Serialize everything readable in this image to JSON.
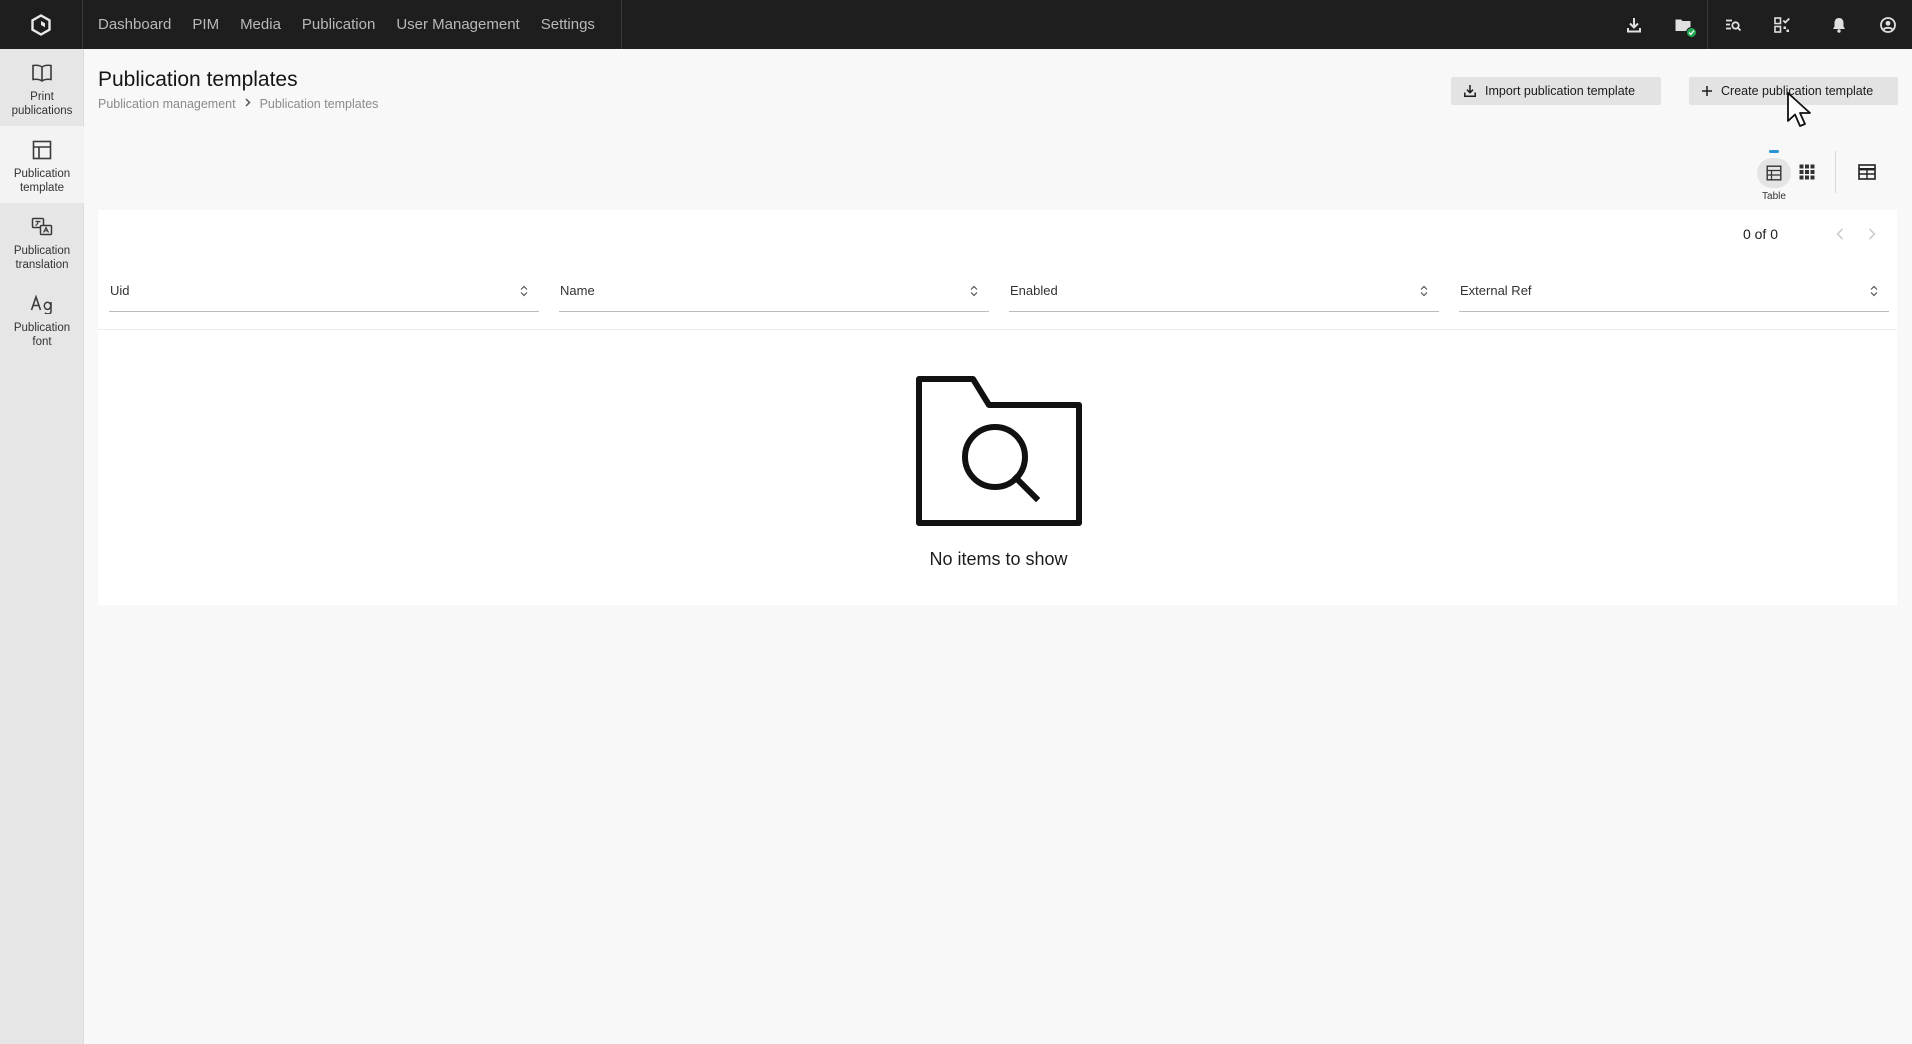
{
  "topbar": {
    "nav": [
      "Dashboard",
      "PIM",
      "Media",
      "Publication",
      "User Management",
      "Settings"
    ],
    "icons": [
      "download-icon",
      "folder-check-icon",
      "search-list-icon",
      "qr-check-icon",
      "bell-icon",
      "account-icon"
    ]
  },
  "sidebar": {
    "items": [
      {
        "label": "Print\npublications",
        "icon": "book-icon",
        "active": false
      },
      {
        "label": "Publication\ntemplate",
        "icon": "layout-icon",
        "active": true
      },
      {
        "label": "Publication\ntranslation",
        "icon": "translate-icon",
        "active": false
      },
      {
        "label": "Publication\nfont",
        "icon": "font-icon",
        "active": false
      }
    ]
  },
  "header": {
    "title": "Publication templates",
    "breadcrumb": [
      "Publication management",
      "Publication templates"
    ],
    "import_label": "Import publication template",
    "create_label": "Create publication template"
  },
  "view": {
    "active": "Table",
    "table_label": "Table"
  },
  "table": {
    "pager": "0 of 0",
    "columns": [
      "Uid",
      "Name",
      "Enabled",
      "External Ref"
    ],
    "rows": [],
    "empty_text": "No items to show"
  },
  "colors": {
    "topbar": "#1e1e1e",
    "accent": "#2a93d5",
    "status_ok": "#26a853"
  }
}
